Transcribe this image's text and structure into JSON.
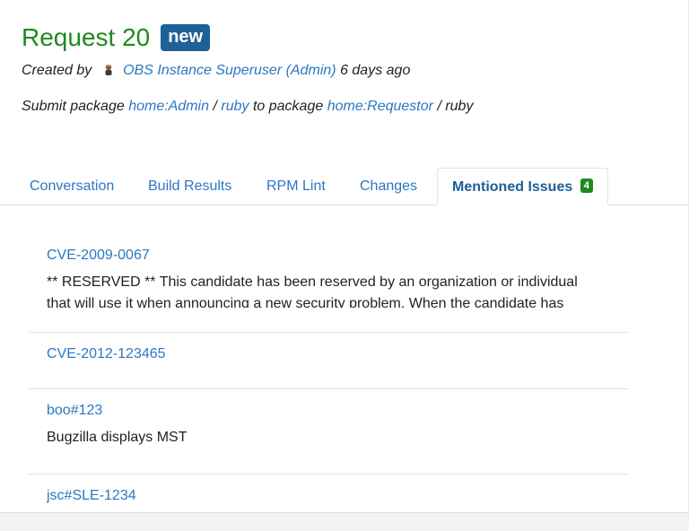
{
  "request": {
    "title": "Request 20",
    "state_badge": "new"
  },
  "meta": {
    "created_by_label": "Created by",
    "creator": "OBS Instance Superuser (Admin)",
    "time_ago": "6 days ago"
  },
  "submit": {
    "prefix": "Submit package",
    "source_project": "home:Admin",
    "sep1": "/",
    "source_package": "ruby",
    "middle": "to package",
    "target_project": "home:Requestor",
    "sep2": "/ ruby"
  },
  "tabs": [
    {
      "label": "Conversation"
    },
    {
      "label": "Build Results"
    },
    {
      "label": "RPM Lint"
    },
    {
      "label": "Changes"
    },
    {
      "label": "Mentioned Issues",
      "count": "4"
    }
  ],
  "issues": [
    {
      "id": "CVE-2009-0067",
      "description": "** RESERVED ** This candidate has been reserved by an organization or individual that will use it when announcing a new security problem. When the candidate has"
    },
    {
      "id": "CVE-2012-123465",
      "description": ""
    },
    {
      "id": "boo#123",
      "description": "Bugzilla displays MST"
    },
    {
      "id": "jsc#SLE-1234",
      "description": ""
    }
  ],
  "colors": {
    "title_green": "#1f8a1f",
    "badge_blue": "#1f6096",
    "link_blue": "#2a78c2",
    "count_green": "#1f8a1f"
  }
}
